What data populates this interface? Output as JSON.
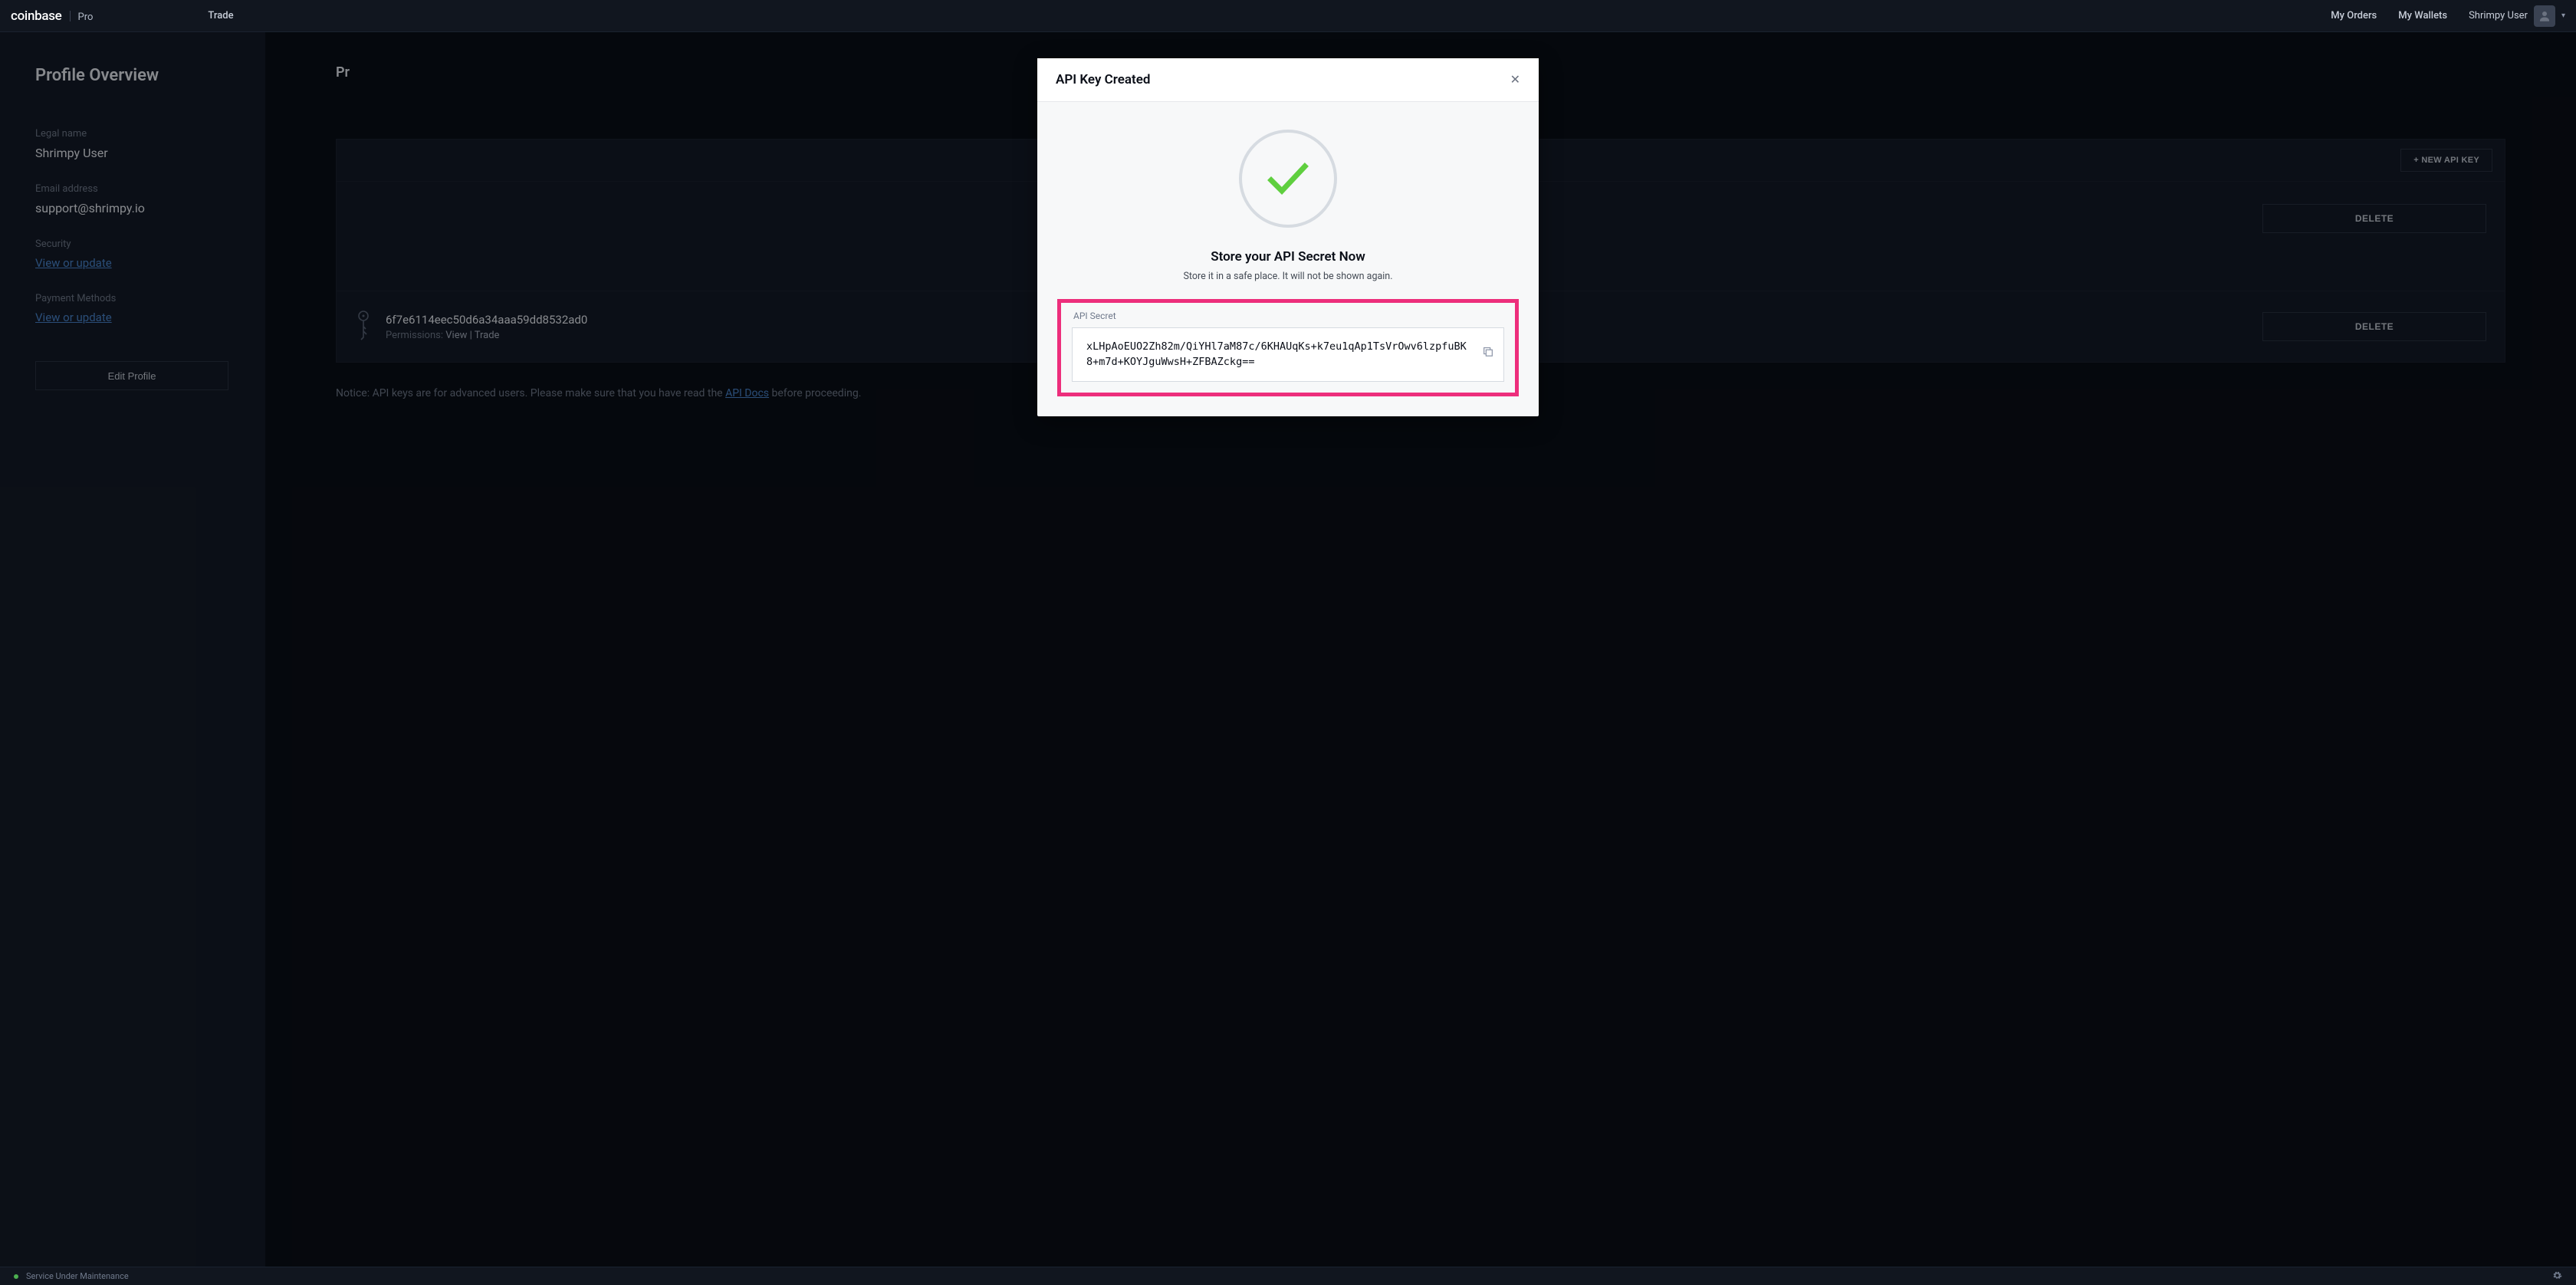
{
  "brand": {
    "coinbase": "coinbase",
    "pro": "Pro"
  },
  "nav": {
    "trade": "Trade",
    "my_orders": "My Orders",
    "my_wallets": "My Wallets",
    "user": "Shrimpy User"
  },
  "sidebar": {
    "title": "Profile Overview",
    "legal_name": {
      "label": "Legal name",
      "value": "Shrimpy User"
    },
    "email": {
      "label": "Email address",
      "value": "support@shrimpy.io"
    },
    "security": {
      "label": "Security",
      "link": "View or update"
    },
    "payment": {
      "label": "Payment Methods",
      "link": "View or update"
    },
    "edit_btn": "Edit Profile"
  },
  "main": {
    "title": "Pr",
    "new_key_btn": "+ NEW API KEY",
    "delete_label": "DELETE",
    "permissions_label": "Permissions:",
    "keys": [
      {
        "id": "",
        "perms": ""
      },
      {
        "id": "6f7e6114eec50d6a34aaa59dd8532ad0",
        "perms": "View | Trade"
      }
    ],
    "notice_prefix": "Notice: API keys are for advanced users. Please make sure that you have read the ",
    "notice_link": "API Docs",
    "notice_suffix": " before proceeding."
  },
  "modal": {
    "title": "API Key Created",
    "subtitle": "Store your API Secret Now",
    "note": "Store it in a safe place. It will not be shown again.",
    "secret_label": "API Secret",
    "secret_value": "xLHpAoEUO2Zh82m/QiYHl7aM87c/6KHAUqKs+k7eu1qAp1TsVrOwv6lzpfuBK8+m7d+KOYJguWwsH+ZFBAZckg=="
  },
  "status": {
    "text": "Service Under Maintenance"
  }
}
